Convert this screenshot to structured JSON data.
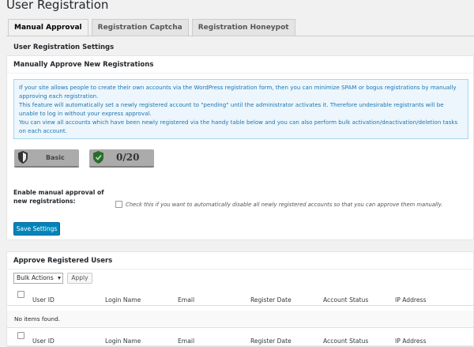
{
  "page": {
    "title": "User Registration"
  },
  "tabs": [
    {
      "label": "Manual Approval",
      "active": true
    },
    {
      "label": "Registration Captcha",
      "active": false
    },
    {
      "label": "Registration Honeypot",
      "active": false
    }
  ],
  "settings_heading": "User Registration Settings",
  "manual_box": {
    "title": "Manually Approve New Registrations",
    "info": [
      "If your site allows people to create their own accounts via the WordPress registration form, then you can minimize SPAM or bogus registrations by manually approving each registration.",
      "This feature will automatically set a newly registered account to \"pending\" until the administrator activates it. Therefore undesirable registrants will be unable to log in without your express approval.",
      "You can view all accounts which have been newly registered via the handy table below and you can also perform bulk activation/deactivation/deletion tasks on each account."
    ],
    "badge_level": "Basic",
    "badge_score": "0/20",
    "option_label": "Enable manual approval of new registrations:",
    "option_checked": false,
    "option_desc": "Check this if you want to automatically disable all newly registered accounts so that you can approve them manually.",
    "save_label": "Save Settings"
  },
  "approve_box": {
    "title": "Approve Registered Users",
    "bulk_select": "Bulk Actions",
    "apply_label": "Apply",
    "columns": [
      "User ID",
      "Login Name",
      "Email",
      "Register Date",
      "Account Status",
      "IP Address"
    ],
    "empty_text": "No items found."
  },
  "colors": {
    "primary_button": "#0085ba",
    "info_bg": "#ecf6fc",
    "info_text": "#1e75b3",
    "badge_grey": "#ababab"
  }
}
